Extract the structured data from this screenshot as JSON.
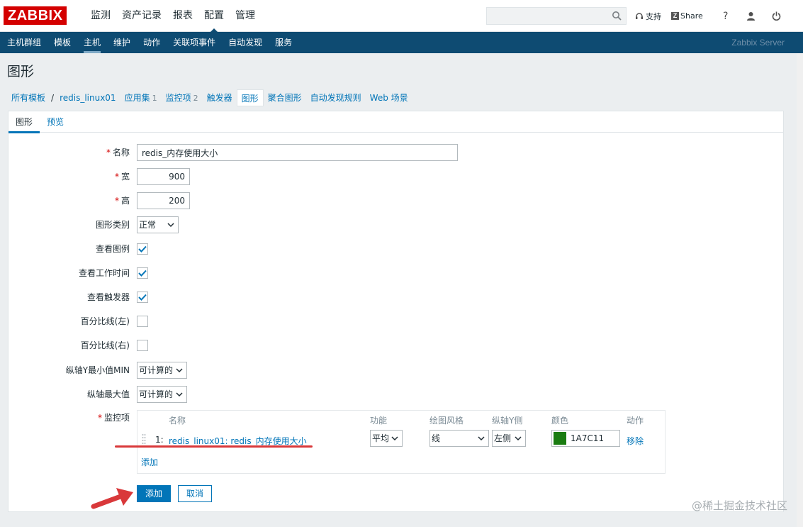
{
  "header": {
    "logo": "ZABBIX",
    "menu": [
      "监测",
      "资产记录",
      "报表",
      "配置",
      "管理"
    ],
    "active_menu_index": 3,
    "search_value": "",
    "support_label": "支持",
    "share_label": "Share"
  },
  "submenu": {
    "items": [
      "主机群组",
      "模板",
      "主机",
      "维护",
      "动作",
      "关联项事件",
      "自动发现",
      "服务"
    ],
    "active_index": 2,
    "server_name": "Zabbix Server"
  },
  "page": {
    "title": "图形",
    "breadcrumbs": {
      "all_templates": "所有模板",
      "separator": "/",
      "host": "redis_linux01",
      "apps": "应用集",
      "apps_count": "1",
      "items": "监控项",
      "items_count": "2",
      "triggers": "触发器",
      "graphs": "图形",
      "screens": "聚合图形",
      "discovery": "自动发现规则",
      "web": "Web 场景"
    },
    "tabs": [
      "图形",
      "预览"
    ]
  },
  "form": {
    "name_label": "名称",
    "name_value": "redis_内存使用大小",
    "width_label": "宽",
    "width_value": "900",
    "height_label": "高",
    "height_value": "200",
    "graph_type_label": "图形类别",
    "graph_type_value": "正常",
    "show_legend_label": "查看图例",
    "show_legend": true,
    "show_work_period_label": "查看工作时间",
    "show_work_period": true,
    "show_triggers_label": "查看触发器",
    "show_triggers": true,
    "percent_left_label": "百分比线(左)",
    "percent_left": false,
    "percent_right_label": "百分比线(右)",
    "percent_right": false,
    "ymin_label": "纵轴Y最小值MIN",
    "ymin_value": "可计算的",
    "ymax_label": "纵轴最大值",
    "ymax_value": "可计算的",
    "items_label": "监控项",
    "items_table": {
      "headers": {
        "name": "名称",
        "function": "功能",
        "draw_style": "绘图风格",
        "y_side": "纵轴Y侧",
        "color": "颜色",
        "action": "动作"
      },
      "rows": [
        {
          "index": "1:",
          "name": "redis_linux01: redis_内存使用大小",
          "function": "平均",
          "draw_style": "线",
          "y_side": "左侧",
          "color": "1A7C11",
          "color_hex": "#1a7c11",
          "action": "移除"
        }
      ],
      "add_link": "添加"
    },
    "submit_label": "添加",
    "cancel_label": "取消"
  },
  "watermark": "@稀土掘金技术社区",
  "colors": {
    "brand_red": "#d40000",
    "nav_blue": "#0e4b72",
    "link_blue": "#0275b8",
    "annotation_red": "#d9383a"
  }
}
